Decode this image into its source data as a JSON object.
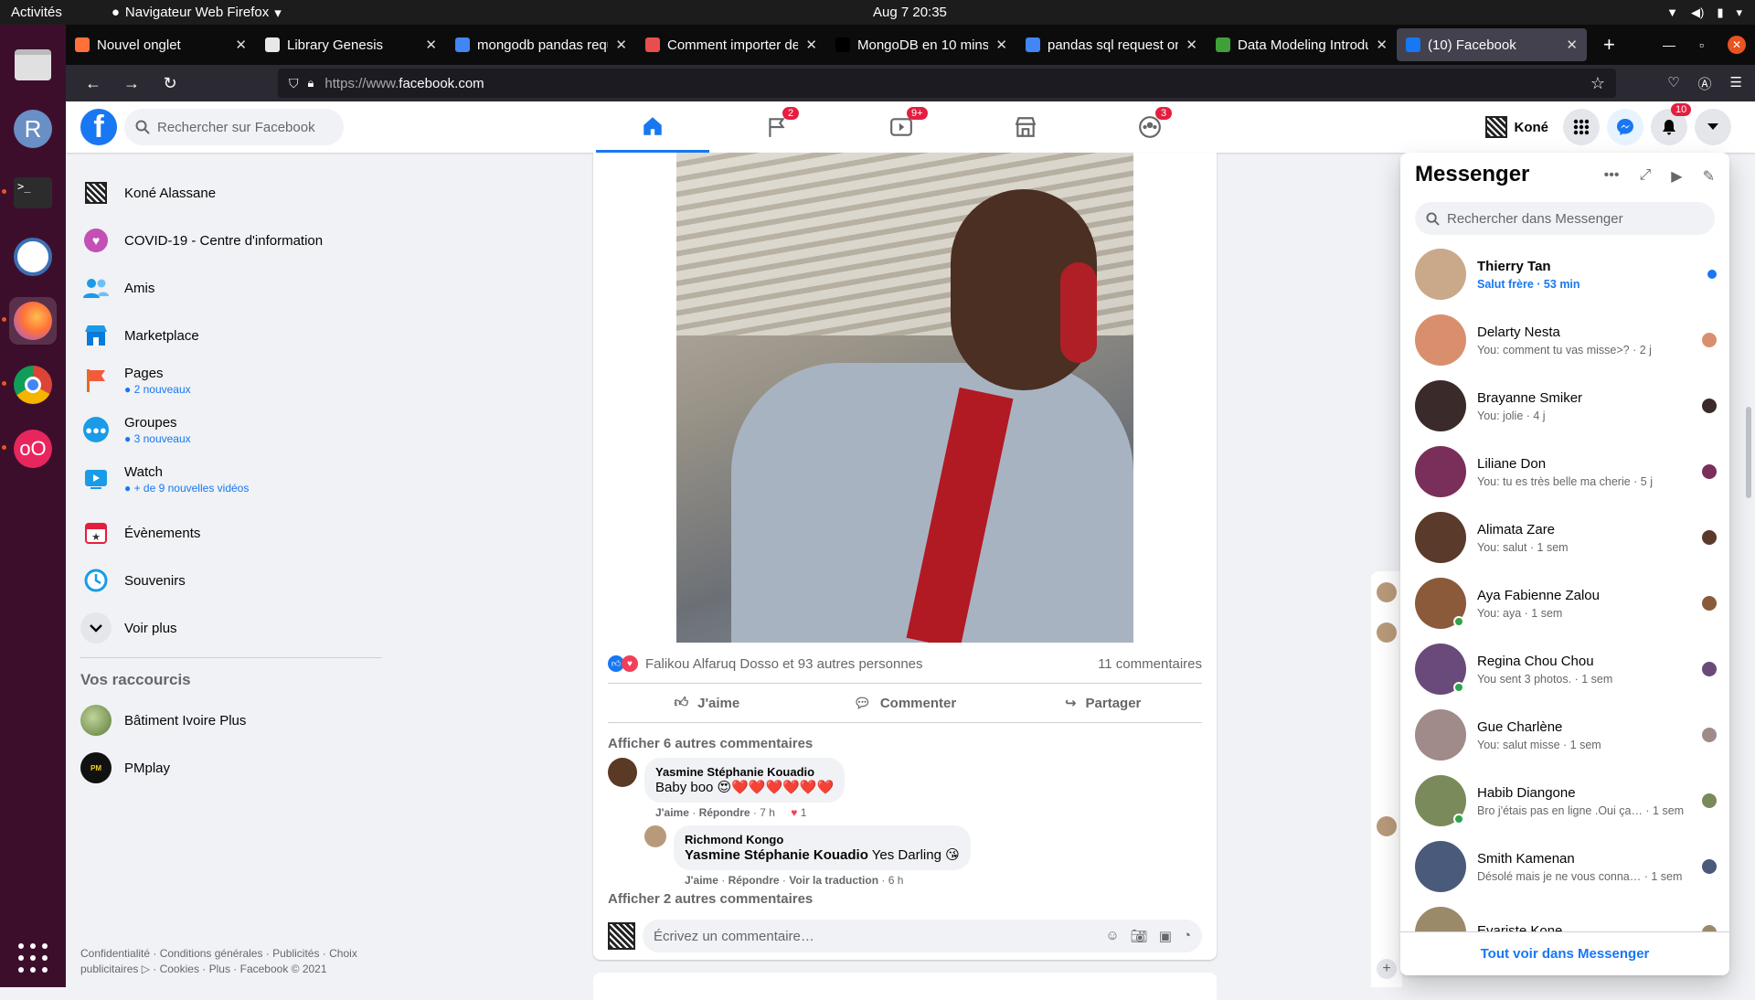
{
  "system": {
    "activities": "Activités",
    "app": "Navigateur Web Firefox",
    "clock": "Aug 7  20:35"
  },
  "tabs": [
    {
      "title": "Nouvel onglet",
      "fav": "#ff7139"
    },
    {
      "title": "Library Genesis",
      "fav": "#e8e8e8"
    },
    {
      "title": "mongodb pandas reque",
      "fav": "#4285f4"
    },
    {
      "title": "Comment importer de",
      "fav": "#e94e4e"
    },
    {
      "title": "MongoDB en 10 mins:",
      "fav": "#000000"
    },
    {
      "title": "pandas sql request on",
      "fav": "#4285f4"
    },
    {
      "title": "Data Modeling Introdu",
      "fav": "#3fa037"
    },
    {
      "title": "(10) Facebook",
      "fav": "#1877f2"
    }
  ],
  "url": {
    "prefix": "https://www.",
    "domain": "facebook.com"
  },
  "fb": {
    "search_placeholder": "Rechercher sur Facebook",
    "badges": {
      "pages": "2",
      "watch": "9+",
      "groups": "3",
      "notifications": "10"
    },
    "user": "Koné"
  },
  "left": {
    "items": [
      {
        "label": "Koné Alassane",
        "sub": ""
      },
      {
        "label": "COVID-19 - Centre d'information",
        "sub": ""
      },
      {
        "label": "Amis",
        "sub": ""
      },
      {
        "label": "Marketplace",
        "sub": ""
      },
      {
        "label": "Pages",
        "sub": "● 2 nouveaux"
      },
      {
        "label": "Groupes",
        "sub": "● 3 nouveaux"
      },
      {
        "label": "Watch",
        "sub": "● + de 9 nouvelles vidéos"
      },
      {
        "label": "Évènements",
        "sub": ""
      },
      {
        "label": "Souvenirs",
        "sub": ""
      },
      {
        "label": "Voir plus",
        "sub": ""
      }
    ],
    "shortcuts_title": "Vos raccourcis",
    "shortcuts": [
      "Bâtiment Ivoire Plus",
      "PMplay"
    ],
    "footer": "Confidentialité · Conditions générales · Publicités · Choix publicitaires ▷ · Cookies · Plus · Facebook © 2021"
  },
  "post": {
    "reactions": "Falikou Alfaruq Dosso et 93 autres personnes",
    "comments_count": "11 commentaires",
    "actions": [
      "J'aime",
      "Commenter",
      "Partager"
    ],
    "more_comments_1": "Afficher 6 autres commentaires",
    "c1": {
      "name": "Yasmine Stéphanie Kouadio",
      "text": "Baby boo 😍❤️❤️❤️❤️❤️❤️",
      "like": "J'aime",
      "reply": "Répondre",
      "time": "7 h",
      "react_count": "1"
    },
    "c2": {
      "name": "Richmond Kongo",
      "mention": "Yasmine Stéphanie Kouadio",
      "text": " Yes Darling 😘",
      "like": "J'aime",
      "reply": "Répondre",
      "translate": "Voir la traduction",
      "time": "6 h"
    },
    "more_comments_2": "Afficher 2 autres commentaires",
    "write_placeholder": "Écrivez un commentaire…"
  },
  "messenger": {
    "title": "Messenger",
    "search_placeholder": "Rechercher dans Messenger",
    "conversations": [
      {
        "name": "Thierry Tan",
        "preview": "Salut frère · 53 min",
        "unread": true,
        "online": false,
        "color": "#c9a98a"
      },
      {
        "name": "Delarty Nesta",
        "preview": "You: comment tu vas misse>? · 2 j",
        "unread": false,
        "online": false,
        "color": "#d98f6e"
      },
      {
        "name": "Brayanne Smiker",
        "preview": "You: jolie · 4 j",
        "unread": false,
        "online": false,
        "color": "#3a2a2a"
      },
      {
        "name": "Liliane Don",
        "preview": "You: tu es très belle ma cherie · 5 j",
        "unread": false,
        "online": false,
        "color": "#7a2f5a"
      },
      {
        "name": "Alimata Zare",
        "preview": "You: salut · 1 sem",
        "unread": false,
        "online": false,
        "color": "#5a3a2a"
      },
      {
        "name": "Aya Fabienne Zalou",
        "preview": "You: aya · 1 sem",
        "unread": false,
        "online": true,
        "color": "#8a5a3a"
      },
      {
        "name": "Regina Chou Chou",
        "preview": "You sent 3 photos. · 1 sem",
        "unread": false,
        "online": true,
        "color": "#6a4a7a"
      },
      {
        "name": "Gue Charlène",
        "preview": "You: salut misse · 1 sem",
        "unread": false,
        "online": false,
        "color": "#a08a8a"
      },
      {
        "name": "Habib Diangone",
        "preview": "Bro j'étais pas en ligne .Oui ça… · 1 sem",
        "unread": false,
        "online": true,
        "color": "#7a8a5a"
      },
      {
        "name": "Smith Kamenan",
        "preview": "Désolé mais je ne vous conna… · 1 sem",
        "unread": false,
        "online": false,
        "color": "#4a5a7a"
      },
      {
        "name": "Evariste Kone",
        "preview": "",
        "unread": false,
        "online": false,
        "color": "#9a8a6a"
      }
    ],
    "footer": "Tout voir dans Messenger"
  }
}
